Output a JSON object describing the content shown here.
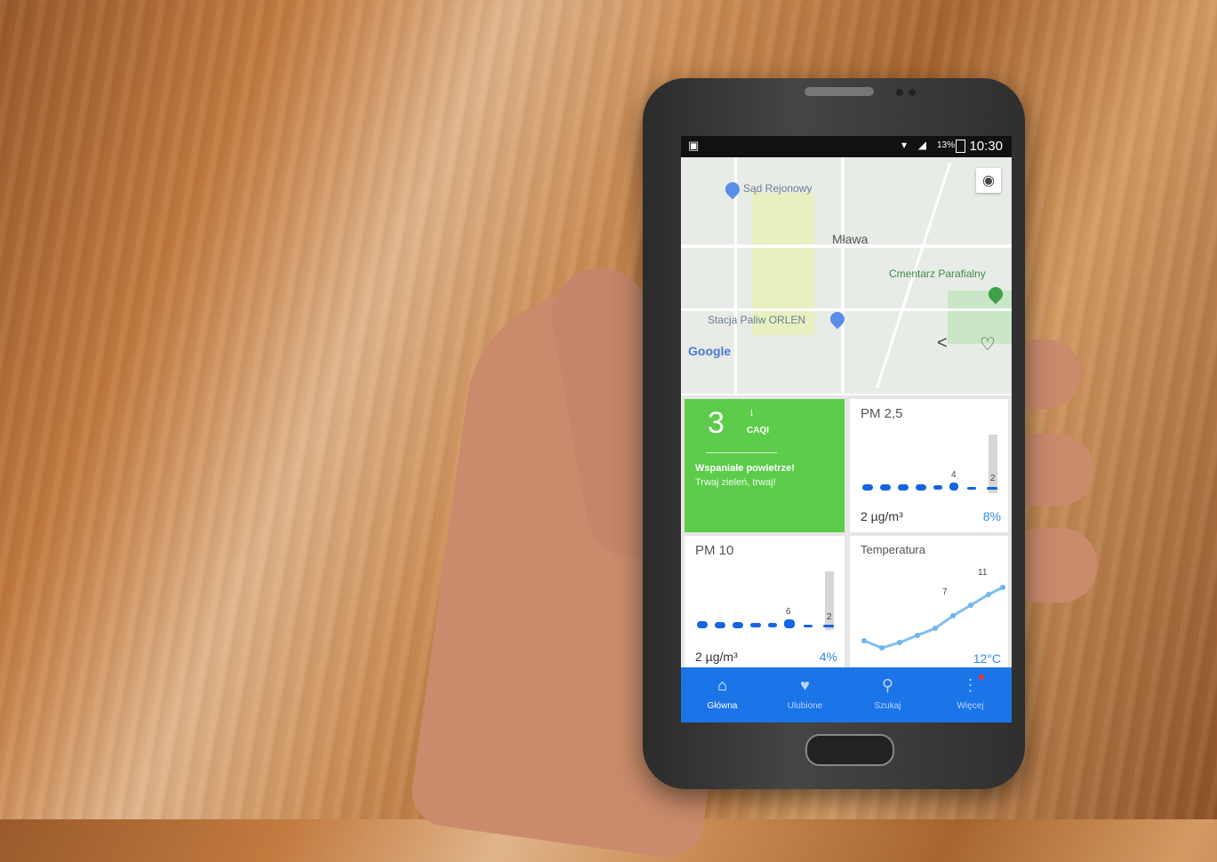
{
  "status": {
    "time": "10:30",
    "battery": "13%"
  },
  "map": {
    "labels": {
      "sad": "Sąd Rejonowy",
      "city": "Mława",
      "cemetery": "Cmentarz Parafialny",
      "station": "Stacja Paliw ORLEN",
      "google": "Google"
    }
  },
  "caqi": {
    "value": "3",
    "label": "CAQI",
    "message": "Wspaniałe powietrze!",
    "subtitle": "Trwaj zieleń, trwaj!",
    "color": "#5ccc4a"
  },
  "tiles": {
    "pm25": {
      "title": "PM 2,5",
      "value": "2 µg/m³",
      "percent": "8%",
      "peak_label": "4",
      "current_label": "2"
    },
    "pm10": {
      "title": "PM 10",
      "value": "2 µg/m³",
      "percent": "4%",
      "peak_label": "6",
      "current_label": "2"
    },
    "temp": {
      "title": "Temperatura",
      "value": "12°C",
      "mid_label": "7",
      "peak_label": "11"
    }
  },
  "nav": {
    "items": [
      {
        "label": "Główna",
        "icon": "home-icon"
      },
      {
        "label": "Ulubione",
        "icon": "heart-icon"
      },
      {
        "label": "Szukaj",
        "icon": "search-icon"
      },
      {
        "label": "Więcej",
        "icon": "more-icon"
      }
    ],
    "accent": "#1b74e8"
  }
}
